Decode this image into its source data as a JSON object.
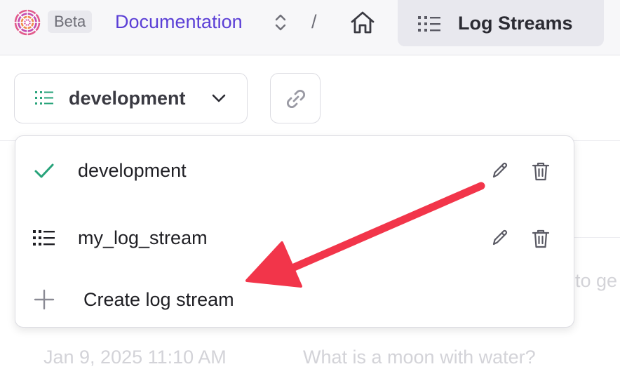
{
  "topbar": {
    "logo_icon": "spiral-logo-icon",
    "badge": "Beta",
    "project_name": "Documentation",
    "separator": "/",
    "home_icon": "home-icon",
    "active_tab": {
      "label": "Log Streams",
      "icon": "list-icon"
    }
  },
  "toolbar": {
    "env_select": {
      "value": "development",
      "icon": "list-icon",
      "chevron": "chevron-down-icon"
    },
    "link_button": {
      "icon": "link-icon"
    }
  },
  "dropdown": {
    "items": [
      {
        "label": "development",
        "icon": "check-icon",
        "selected": true
      },
      {
        "label": "my_log_stream",
        "icon": "list-icon",
        "selected": false
      }
    ],
    "create_label": "Create log stream",
    "create_icon": "plus-icon"
  },
  "background": {
    "fragment_right": "to ge",
    "row_timestamp": "Jan 9, 2025 11:10 AM",
    "row_text": "What is a moon with water?"
  },
  "colors": {
    "accent": "#5b3fd6",
    "check": "#27a37a",
    "annotation_arrow": "#f2354a"
  }
}
